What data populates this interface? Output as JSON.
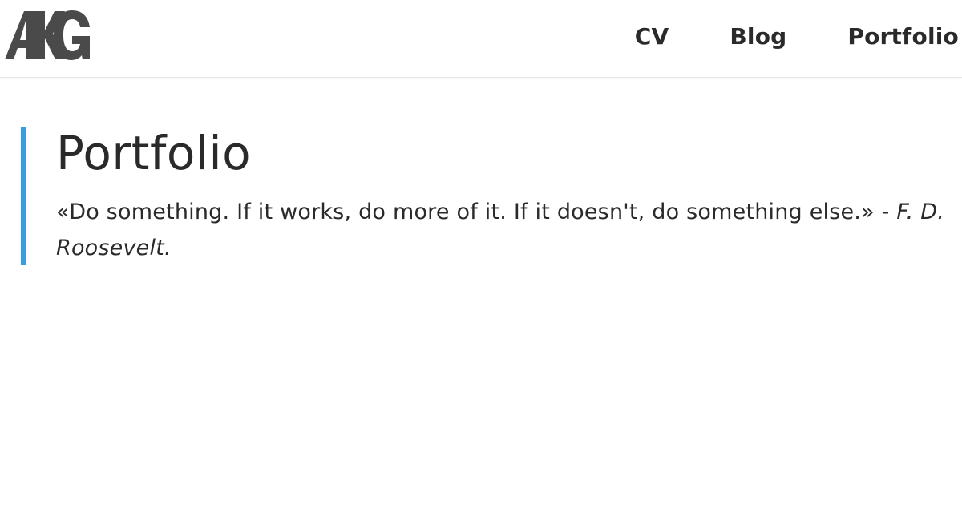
{
  "header": {
    "logo_text": "AKG",
    "logo_color": "#4a4a4a",
    "nav": [
      {
        "label": "CV"
      },
      {
        "label": "Blog"
      },
      {
        "label": "Portfolio"
      }
    ]
  },
  "main": {
    "title": "Portfolio",
    "quote_text": "«Do something. If it works, do more of it. If it doesn't, do something else.» - ",
    "quote_author": "F. D. Roosevelt.",
    "accent_color": "#3b9ddd"
  }
}
